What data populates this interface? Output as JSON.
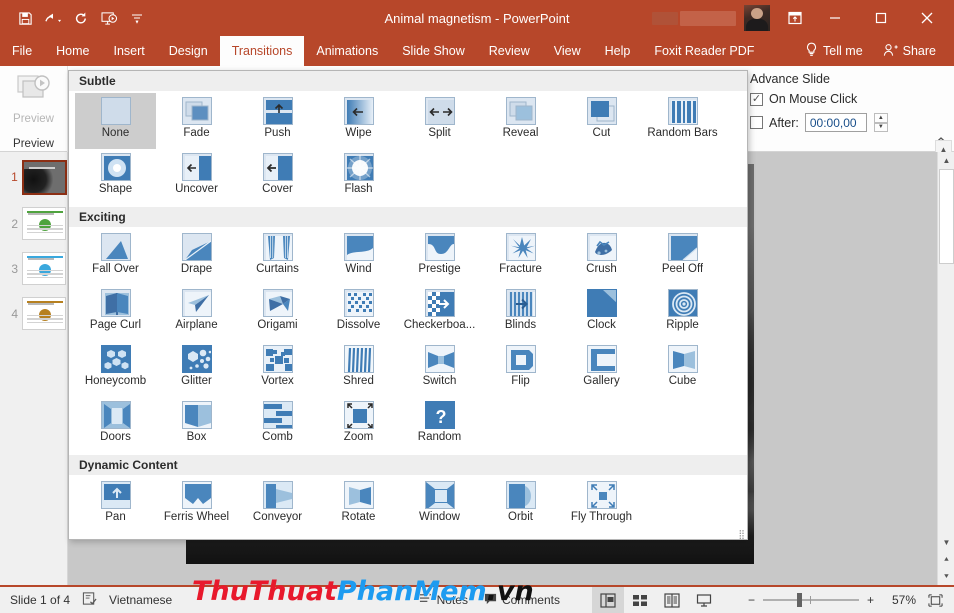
{
  "titlebar": {
    "document_title": "Animal magnetism  -  PowerPoint",
    "qat": [
      {
        "name": "save-icon",
        "label": "Save"
      },
      {
        "name": "undo-icon",
        "label": "Undo"
      },
      {
        "name": "redo-icon",
        "label": "Redo"
      },
      {
        "name": "start-slideshow-icon",
        "label": "Start From Beginning"
      },
      {
        "name": "customize-qat-icon",
        "label": "Customize Quick Access Toolbar"
      }
    ],
    "ribbon_display_options": "Ribbon Display Options",
    "minimize": "Minimize",
    "restore": "Restore Down",
    "close": "Close",
    "accent_color": "#b7472a"
  },
  "tabs": [
    {
      "label": "File",
      "active": false
    },
    {
      "label": "Home",
      "active": false
    },
    {
      "label": "Insert",
      "active": false
    },
    {
      "label": "Design",
      "active": false
    },
    {
      "label": "Transitions",
      "active": true
    },
    {
      "label": "Animations",
      "active": false
    },
    {
      "label": "Slide Show",
      "active": false
    },
    {
      "label": "Review",
      "active": false
    },
    {
      "label": "View",
      "active": false
    },
    {
      "label": "Help",
      "active": false
    },
    {
      "label": "Foxit Reader PDF",
      "active": false
    }
  ],
  "tellme": {
    "label": "Tell me"
  },
  "share": {
    "label": "Share"
  },
  "ribbon": {
    "preview_group": {
      "button_label": "Preview",
      "group_label": "Preview"
    },
    "advance_slide": {
      "title": "Advance Slide",
      "on_mouse_click": {
        "label": "On Mouse Click",
        "checked": true
      },
      "after": {
        "label": "After:",
        "checked": false,
        "value": "00:00,00"
      }
    }
  },
  "thumbnails": [
    {
      "number": "1",
      "active": true,
      "kind": "dark"
    },
    {
      "number": "2",
      "active": false,
      "kind": "light",
      "accent": "#4fa33f"
    },
    {
      "number": "3",
      "active": false,
      "kind": "light",
      "accent": "#3aa8dd"
    },
    {
      "number": "4",
      "active": false,
      "kind": "light",
      "accent": "#b68020"
    }
  ],
  "gallery": {
    "sections": [
      {
        "title": "Subtle",
        "items": [
          {
            "label": "None",
            "icon": "none-icon",
            "selected": true
          },
          {
            "label": "Fade",
            "icon": "fade-icon",
            "selected": false
          },
          {
            "label": "Push",
            "icon": "push-icon",
            "selected": false
          },
          {
            "label": "Wipe",
            "icon": "wipe-icon",
            "selected": false
          },
          {
            "label": "Split",
            "icon": "split-icon",
            "selected": false
          },
          {
            "label": "Reveal",
            "icon": "reveal-icon",
            "selected": false
          },
          {
            "label": "Cut",
            "icon": "cut-icon",
            "selected": false
          },
          {
            "label": "Random Bars",
            "icon": "random-bars-icon",
            "selected": false
          },
          {
            "label": "Shape",
            "icon": "shape-icon",
            "selected": false
          },
          {
            "label": "Uncover",
            "icon": "uncover-icon",
            "selected": false
          },
          {
            "label": "Cover",
            "icon": "cover-icon",
            "selected": false
          },
          {
            "label": "Flash",
            "icon": "flash-icon",
            "selected": false
          }
        ]
      },
      {
        "title": "Exciting",
        "items": [
          {
            "label": "Fall Over",
            "icon": "fall-over-icon",
            "selected": false
          },
          {
            "label": "Drape",
            "icon": "drape-icon",
            "selected": false
          },
          {
            "label": "Curtains",
            "icon": "curtains-icon",
            "selected": false
          },
          {
            "label": "Wind",
            "icon": "wind-icon",
            "selected": false
          },
          {
            "label": "Prestige",
            "icon": "prestige-icon",
            "selected": false
          },
          {
            "label": "Fracture",
            "icon": "fracture-icon",
            "selected": false
          },
          {
            "label": "Crush",
            "icon": "crush-icon",
            "selected": false
          },
          {
            "label": "Peel Off",
            "icon": "peel-off-icon",
            "selected": false
          },
          {
            "label": "Page Curl",
            "icon": "page-curl-icon",
            "selected": false
          },
          {
            "label": "Airplane",
            "icon": "airplane-icon",
            "selected": false
          },
          {
            "label": "Origami",
            "icon": "origami-icon",
            "selected": false
          },
          {
            "label": "Dissolve",
            "icon": "dissolve-icon",
            "selected": false
          },
          {
            "label": "Checkerboa...",
            "icon": "checkerboard-icon",
            "selected": false
          },
          {
            "label": "Blinds",
            "icon": "blinds-icon",
            "selected": false
          },
          {
            "label": "Clock",
            "icon": "clock-icon",
            "selected": false
          },
          {
            "label": "Ripple",
            "icon": "ripple-icon",
            "selected": false
          },
          {
            "label": "Honeycomb",
            "icon": "honeycomb-icon",
            "selected": false
          },
          {
            "label": "Glitter",
            "icon": "glitter-icon",
            "selected": false
          },
          {
            "label": "Vortex",
            "icon": "vortex-icon",
            "selected": false
          },
          {
            "label": "Shred",
            "icon": "shred-icon",
            "selected": false
          },
          {
            "label": "Switch",
            "icon": "switch-icon",
            "selected": false
          },
          {
            "label": "Flip",
            "icon": "flip-icon",
            "selected": false
          },
          {
            "label": "Gallery",
            "icon": "gallery-icon",
            "selected": false
          },
          {
            "label": "Cube",
            "icon": "cube-icon",
            "selected": false
          },
          {
            "label": "Doors",
            "icon": "doors-icon",
            "selected": false
          },
          {
            "label": "Box",
            "icon": "box-icon",
            "selected": false
          },
          {
            "label": "Comb",
            "icon": "comb-icon",
            "selected": false
          },
          {
            "label": "Zoom",
            "icon": "zoom-icon",
            "selected": false
          },
          {
            "label": "Random",
            "icon": "random-icon",
            "selected": false
          }
        ]
      },
      {
        "title": "Dynamic Content",
        "items": [
          {
            "label": "Pan",
            "icon": "pan-icon",
            "selected": false
          },
          {
            "label": "Ferris Wheel",
            "icon": "ferris-wheel-icon",
            "selected": false
          },
          {
            "label": "Conveyor",
            "icon": "conveyor-icon",
            "selected": false
          },
          {
            "label": "Rotate",
            "icon": "rotate-icon",
            "selected": false
          },
          {
            "label": "Window",
            "icon": "window-icon",
            "selected": false
          },
          {
            "label": "Orbit",
            "icon": "orbit-icon",
            "selected": false
          },
          {
            "label": "Fly Through",
            "icon": "fly-through-icon",
            "selected": false
          }
        ]
      }
    ]
  },
  "watermark": {
    "part1": "ThuThuat",
    "part2": "PhanMem",
    "part3": ".vn"
  },
  "statusbar": {
    "slide_counter": "Slide 1 of 4",
    "accessibility_icon": "accessibility-check-icon",
    "language": "Vietnamese",
    "notes": "Notes",
    "comments": "Comments",
    "views": [
      {
        "name": "normal-view-button",
        "active": true
      },
      {
        "name": "slide-sorter-view-button",
        "active": false
      },
      {
        "name": "reading-view-button",
        "active": false
      },
      {
        "name": "slide-show-view-button",
        "active": false
      }
    ],
    "zoom_out": "−",
    "zoom_in": "+",
    "zoom_level": "57%",
    "fit_to_window": "Fit slide to current window"
  }
}
